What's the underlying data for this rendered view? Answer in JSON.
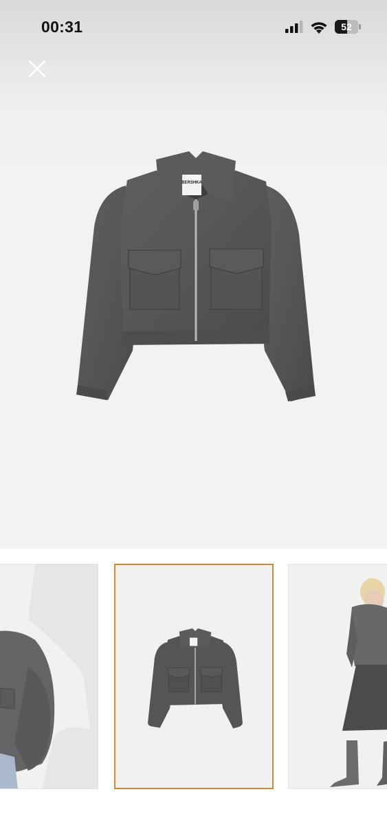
{
  "status_bar": {
    "time": "00:31",
    "battery_level": "52",
    "icons": [
      "signal-icon",
      "wifi-icon",
      "battery-icon"
    ]
  },
  "viewer": {
    "close_icon": "close-icon",
    "main_image": "gray-cropped-jacket",
    "brand_label": "BERSHKA"
  },
  "gallery": {
    "selected_index": 1,
    "thumbnails": [
      "model-back-view",
      "product-jacket",
      "model-side-view"
    ],
    "accent_color": "#d28a3a"
  }
}
